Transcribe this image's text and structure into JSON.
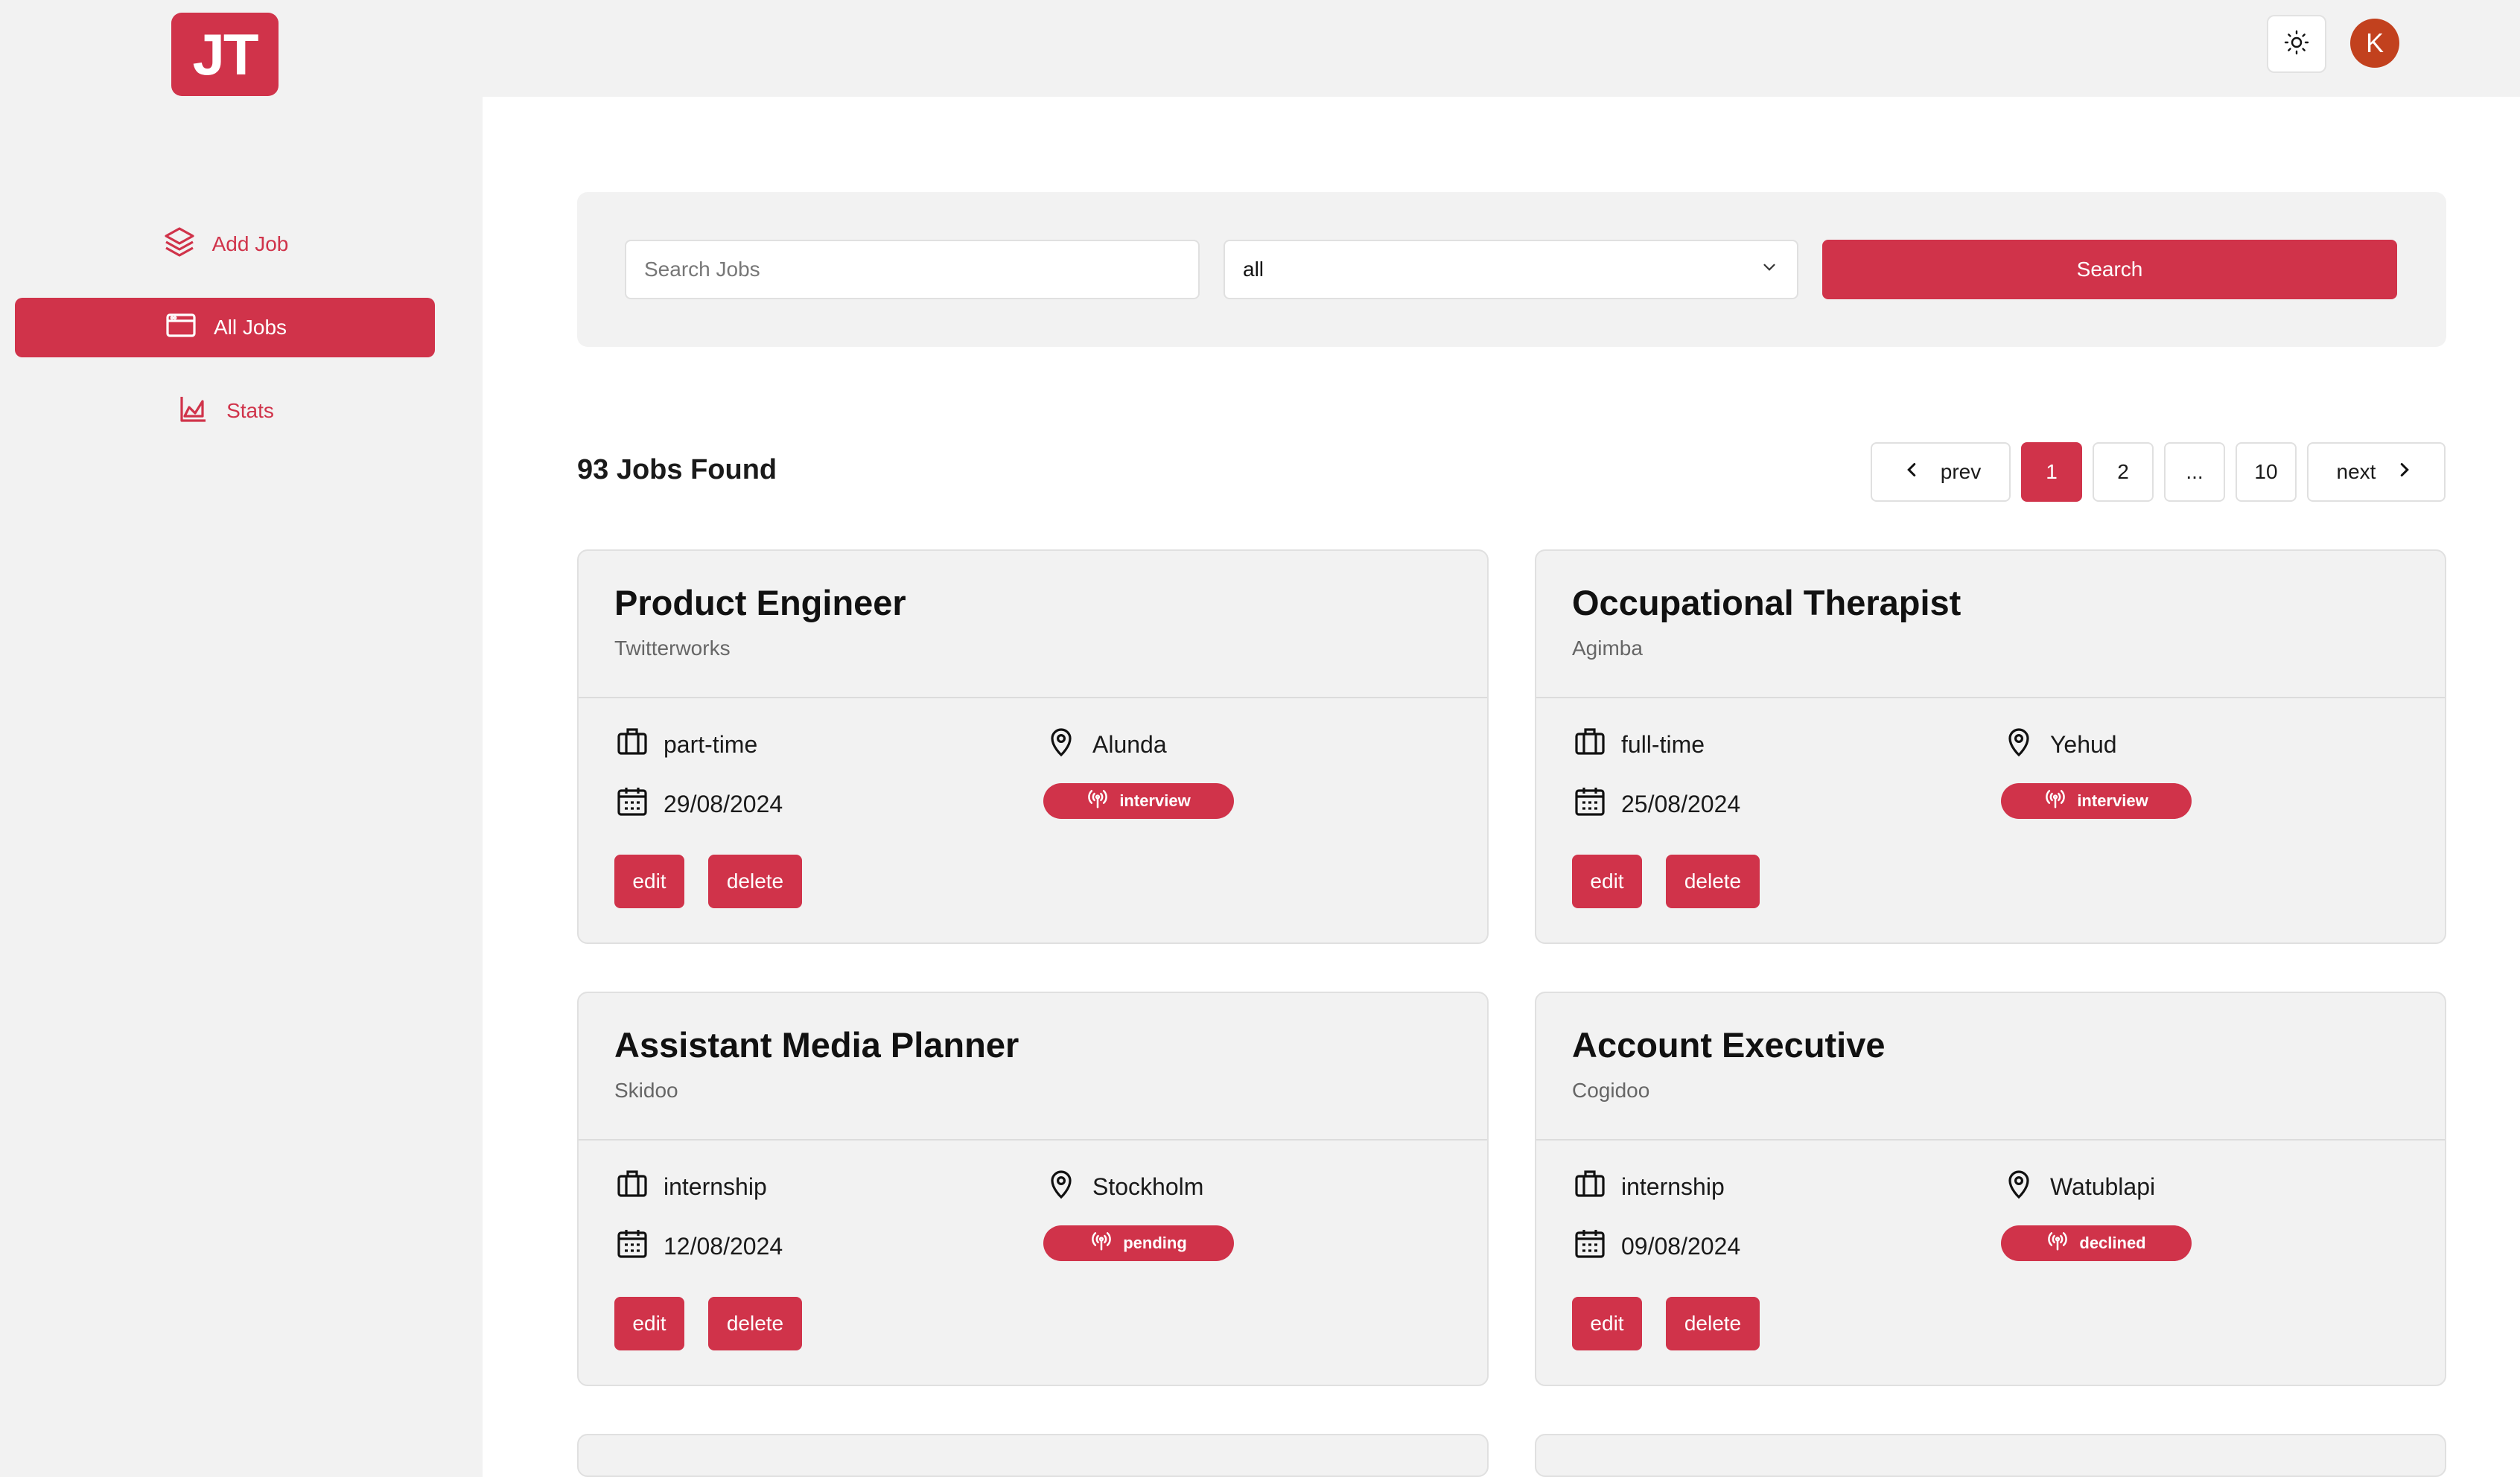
{
  "app": {
    "logo_text": "JT",
    "avatar_initial": "K",
    "accent_color": "#d0334a"
  },
  "sidebar": {
    "items": [
      {
        "label": "Add Job",
        "icon": "layers-icon"
      },
      {
        "label": "All Jobs",
        "icon": "browser-window-icon",
        "active": true
      },
      {
        "label": "Stats",
        "icon": "area-chart-icon"
      }
    ]
  },
  "search": {
    "placeholder": "Search Jobs",
    "status_value": "all",
    "button_label": "Search"
  },
  "results": {
    "count_text": "93 Jobs Found"
  },
  "pagination": {
    "prev_label": "prev",
    "pages": [
      "1",
      "2",
      "...",
      "10"
    ],
    "current_page": "1",
    "next_label": "next"
  },
  "jobs": [
    {
      "position": "Product Engineer",
      "company": "Twitterworks",
      "type": "part-time",
      "location": "Alunda",
      "date": "29/08/2024",
      "status": "interview",
      "edit_label": "edit",
      "delete_label": "delete"
    },
    {
      "position": "Occupational Therapist",
      "company": "Agimba",
      "type": "full-time",
      "location": "Yehud",
      "date": "25/08/2024",
      "status": "interview",
      "edit_label": "edit",
      "delete_label": "delete"
    },
    {
      "position": "Assistant Media Planner",
      "company": "Skidoo",
      "type": "internship",
      "location": "Stockholm",
      "date": "12/08/2024",
      "status": "pending",
      "edit_label": "edit",
      "delete_label": "delete"
    },
    {
      "position": "Account Executive",
      "company": "Cogidoo",
      "type": "internship",
      "location": "Watublapi",
      "date": "09/08/2024",
      "status": "declined",
      "edit_label": "edit",
      "delete_label": "delete"
    }
  ]
}
